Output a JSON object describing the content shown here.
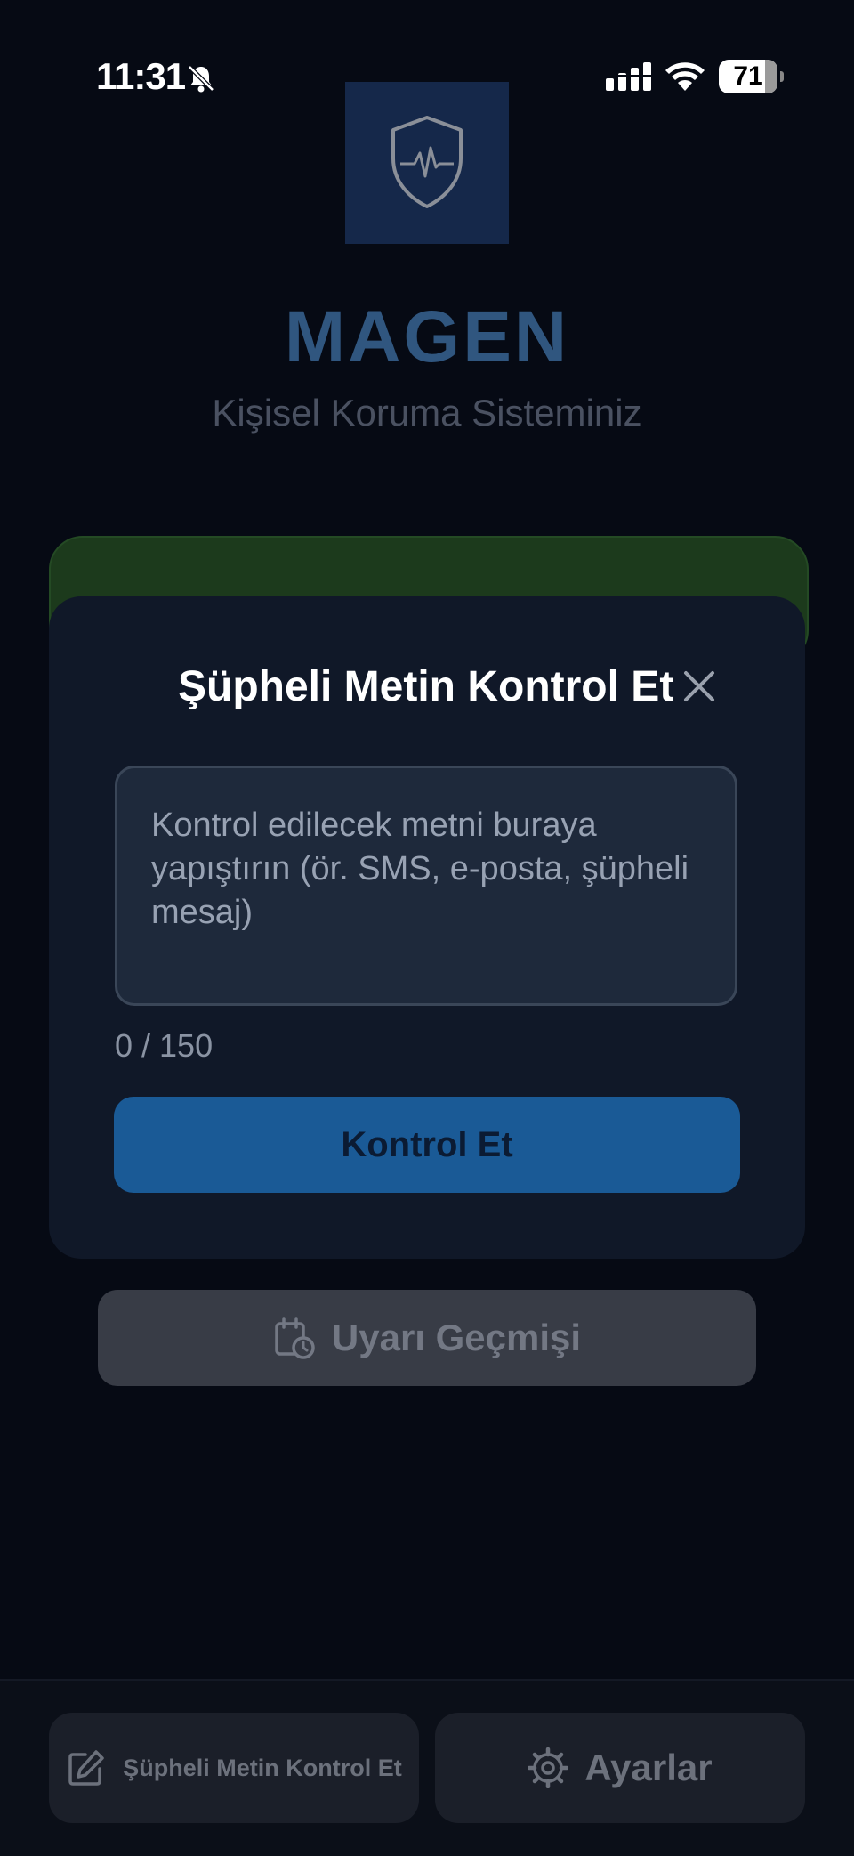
{
  "status_bar": {
    "time": "11:31",
    "battery": "71",
    "icons": [
      "bell-slash-icon",
      "signal-icon",
      "wifi-icon",
      "battery-icon"
    ]
  },
  "header": {
    "logo_icon": "shield-pulse-icon",
    "title": "MAGEN",
    "subtitle": "Kişisel Koruma Sisteminiz"
  },
  "modal": {
    "title": "Şüpheli Metin Kontrol Et",
    "close_icon": "close-icon",
    "input": {
      "value": "",
      "placeholder": "Kontrol edilecek metni buraya yapıştırın (ör. SMS, e-posta, şüpheli mesaj)"
    },
    "counter": "0 / 150",
    "submit_label": "Kontrol Et"
  },
  "history_button": {
    "label": "Uyarı Geçmişi",
    "icon": "calendar-clock-icon"
  },
  "bottom_nav": {
    "check_text": {
      "label": "Şüpheli Metin Kontrol Et",
      "icon": "edit-icon"
    },
    "settings": {
      "label": "Ayarlar",
      "icon": "gear-icon"
    }
  },
  "colors": {
    "background": "#060a14",
    "modal": "#101828",
    "accent": "#1a5a96",
    "title": "#30567f",
    "green_card": "#1c3a1c"
  }
}
